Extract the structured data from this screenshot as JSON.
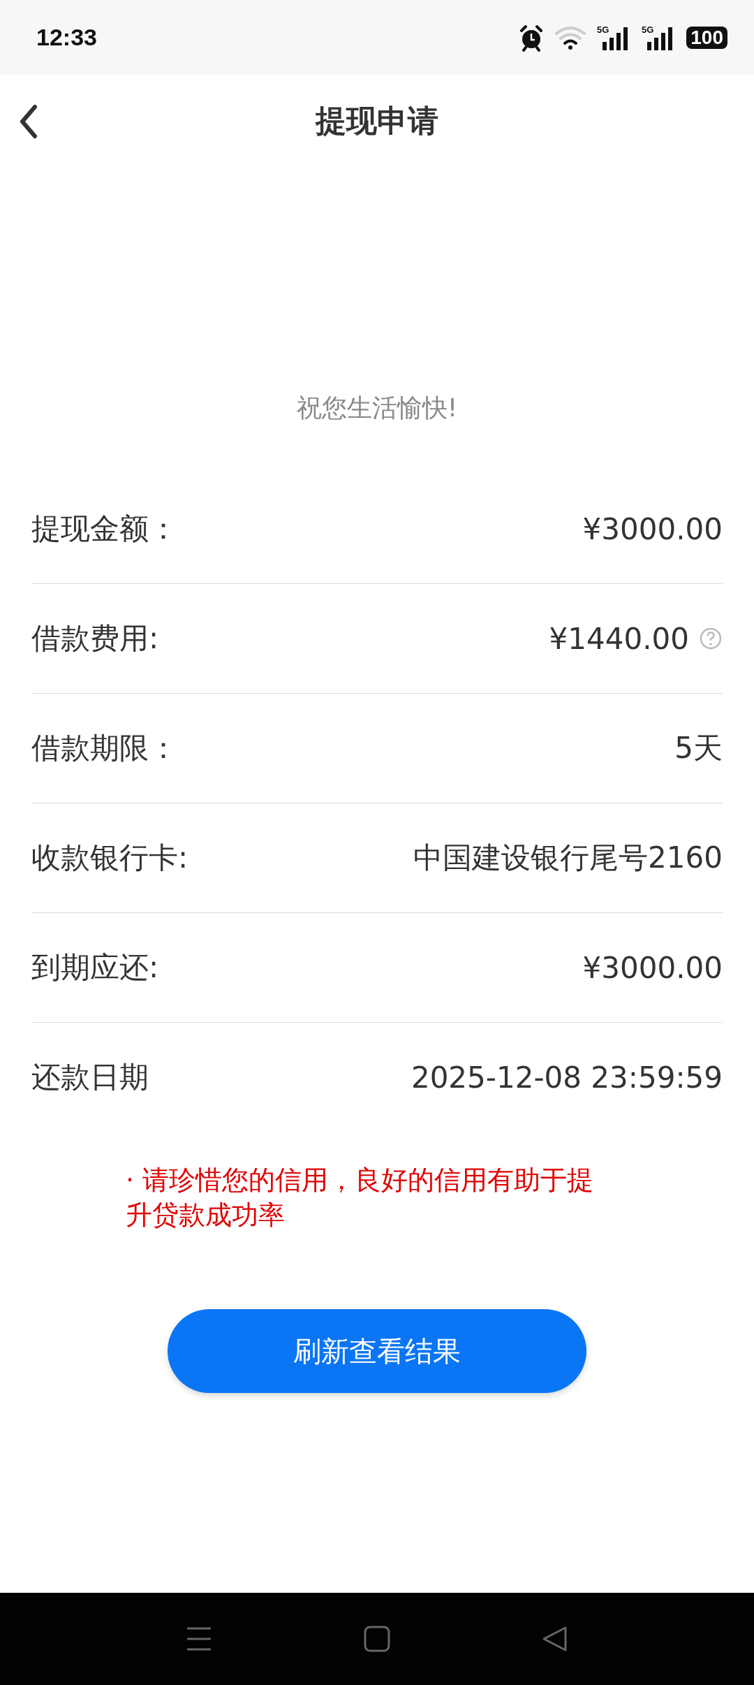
{
  "status_bar": {
    "time": "12:33",
    "networks": [
      "5G",
      "5G"
    ],
    "battery": "100"
  },
  "header": {
    "title": "提现申请"
  },
  "greeting": "祝您生活愉快!",
  "details": [
    {
      "label": "提现金额：",
      "value": "¥3000.00",
      "help": false
    },
    {
      "label": "借款费用:",
      "value": "¥1440.00",
      "help": true
    },
    {
      "label": "借款期限：",
      "value": "5天",
      "help": false
    },
    {
      "label": "收款银行卡:",
      "value": "中国建设银行尾号2160",
      "help": false
    },
    {
      "label": "到期应还:",
      "value": "¥3000.00",
      "help": false
    },
    {
      "label": "还款日期",
      "value": "2025-12-08 23:59:59",
      "help": false
    }
  ],
  "notice": "· 请珍惜您的信用，良好的信用有助于提升贷款成功率",
  "button": "刷新查看结果"
}
